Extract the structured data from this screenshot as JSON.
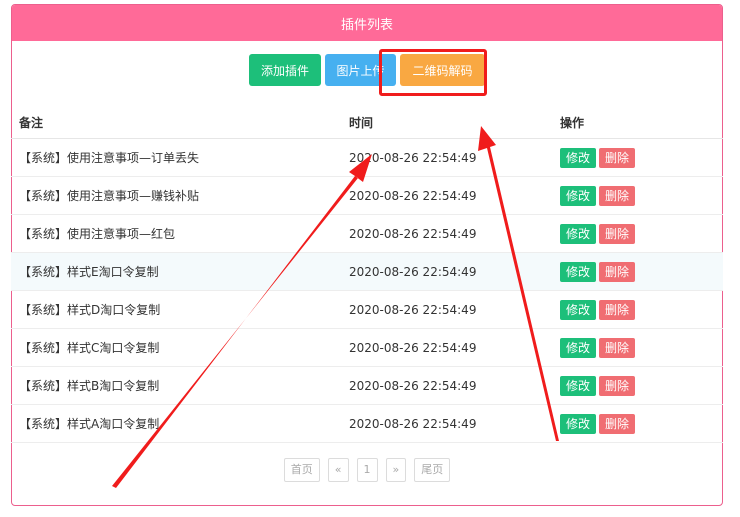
{
  "panel": {
    "title": "插件列表"
  },
  "toolbar": {
    "add_label": "添加插件",
    "upload_label": "图片上传",
    "qrcode_label": "二维码解码"
  },
  "table": {
    "headers": [
      "备注",
      "时间",
      "操作"
    ],
    "rows": [
      {
        "note": "【系统】使用注意事项—订单丢失",
        "time": "2020-08-26 22:54:49",
        "edit": "修改",
        "delete": "删除"
      },
      {
        "note": "【系统】使用注意事项—赚钱补贴",
        "time": "2020-08-26 22:54:49",
        "edit": "修改",
        "delete": "删除"
      },
      {
        "note": "【系统】使用注意事项—红包",
        "time": "2020-08-26 22:54:49",
        "edit": "修改",
        "delete": "删除"
      },
      {
        "note": "【系统】样式E淘口令复制",
        "time": "2020-08-26 22:54:49",
        "edit": "修改",
        "delete": "删除"
      },
      {
        "note": "【系统】样式D淘口令复制",
        "time": "2020-08-26 22:54:49",
        "edit": "修改",
        "delete": "删除"
      },
      {
        "note": "【系统】样式C淘口令复制",
        "time": "2020-08-26 22:54:49",
        "edit": "修改",
        "delete": "删除"
      },
      {
        "note": "【系统】样式B淘口令复制",
        "time": "2020-08-26 22:54:49",
        "edit": "修改",
        "delete": "删除"
      },
      {
        "note": "【系统】样式A淘口令复制",
        "time": "2020-08-26 22:54:49",
        "edit": "修改",
        "delete": "删除"
      }
    ]
  },
  "pager": {
    "first": "首页",
    "prev": "«",
    "current": "1",
    "next": "»",
    "last": "尾页"
  },
  "colors": {
    "header": "#ff6a98",
    "green": "#1dbf7a",
    "blue": "#46b0f0",
    "orange": "#f9a842",
    "delete": "#f06d72",
    "annotation": "#f01c1c"
  }
}
